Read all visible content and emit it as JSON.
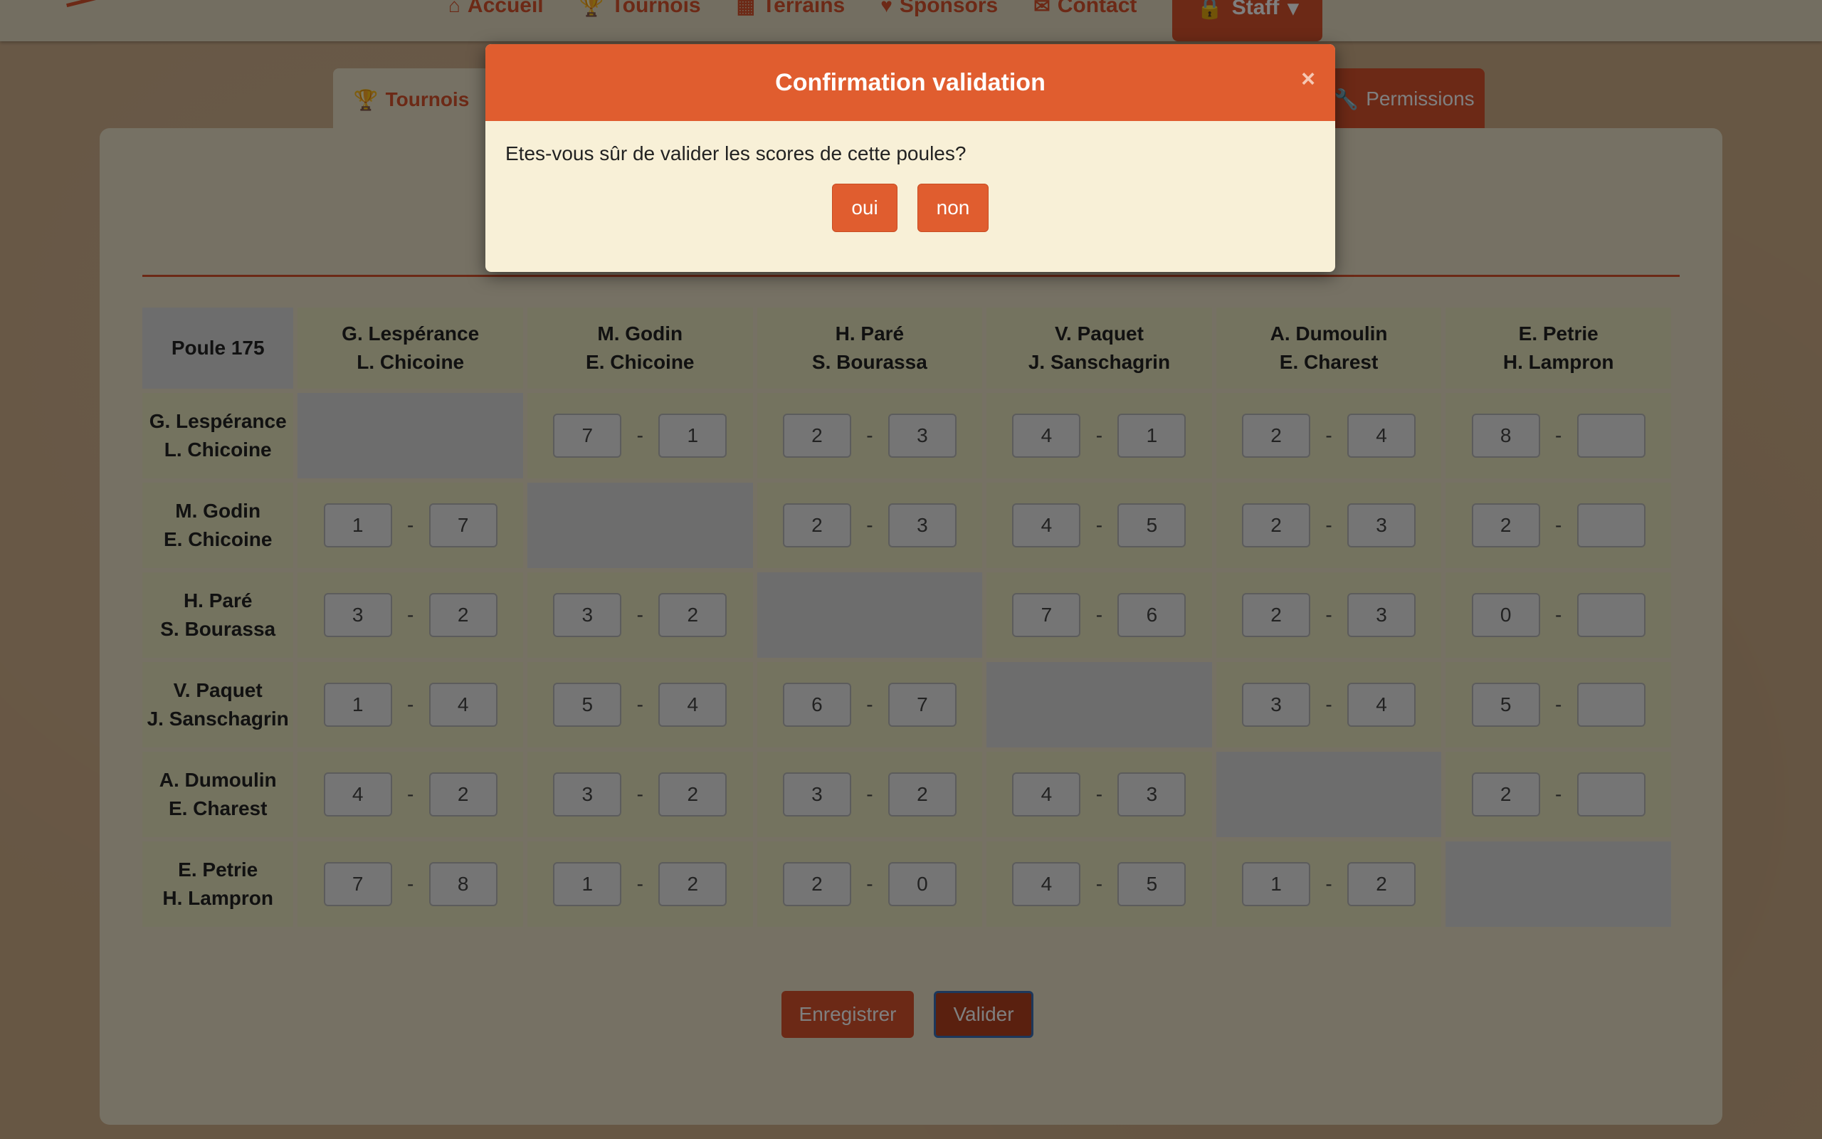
{
  "nav": {
    "items": [
      {
        "label": "Accueil",
        "icon": "home-icon",
        "glyph": "⌂"
      },
      {
        "label": "Tournois",
        "icon": "trophy-icon",
        "glyph": "🏆"
      },
      {
        "label": "Terrains",
        "icon": "grid-icon",
        "glyph": "▦"
      },
      {
        "label": "Sponsors",
        "icon": "heart-icon",
        "glyph": "♥"
      },
      {
        "label": "Contact",
        "icon": "envelope-icon",
        "glyph": "✉"
      }
    ],
    "staff": {
      "label": "Staff",
      "icon": "lock-icon",
      "glyph": "🔒",
      "caret": "▾"
    }
  },
  "tabs": {
    "tournois": {
      "label": "Tournois",
      "glyph": "🏆"
    },
    "permissions": {
      "label": "Permissions",
      "glyph": "🔧"
    }
  },
  "poule": {
    "title": "Poule 175",
    "columns": [
      {
        "line1": "G. Lespérance",
        "line2": "L. Chicoine"
      },
      {
        "line1": "M. Godin",
        "line2": "E. Chicoine"
      },
      {
        "line1": "H. Paré",
        "line2": "S. Bourassa"
      },
      {
        "line1": "V. Paquet",
        "line2": "J. Sanschagrin"
      },
      {
        "line1": "A. Dumoulin",
        "line2": "E. Charest"
      },
      {
        "line1": "E. Petrie",
        "line2": "H. Lampron"
      }
    ],
    "rows": [
      {
        "line1": "G. Lespérance",
        "line2": "L. Chicoine",
        "scores": [
          null,
          [
            "7",
            "1"
          ],
          [
            "2",
            "3"
          ],
          [
            "4",
            "1"
          ],
          [
            "2",
            "4"
          ],
          [
            "8",
            ""
          ]
        ]
      },
      {
        "line1": "M. Godin",
        "line2": "E. Chicoine",
        "scores": [
          [
            "1",
            "7"
          ],
          null,
          [
            "2",
            "3"
          ],
          [
            "4",
            "5"
          ],
          [
            "2",
            "3"
          ],
          [
            "2",
            ""
          ]
        ]
      },
      {
        "line1": "H. Paré",
        "line2": "S. Bourassa",
        "scores": [
          [
            "3",
            "2"
          ],
          [
            "3",
            "2"
          ],
          null,
          [
            "7",
            "6"
          ],
          [
            "2",
            "3"
          ],
          [
            "0",
            ""
          ]
        ]
      },
      {
        "line1": "V. Paquet",
        "line2": "J. Sanschagrin",
        "scores": [
          [
            "1",
            "4"
          ],
          [
            "5",
            "4"
          ],
          [
            "6",
            "7"
          ],
          null,
          [
            "3",
            "4"
          ],
          [
            "5",
            ""
          ]
        ]
      },
      {
        "line1": "A. Dumoulin",
        "line2": "E. Charest",
        "scores": [
          [
            "4",
            "2"
          ],
          [
            "3",
            "2"
          ],
          [
            "3",
            "2"
          ],
          [
            "4",
            "3"
          ],
          null,
          [
            "2",
            ""
          ]
        ]
      },
      {
        "line1": "E. Petrie",
        "line2": "H. Lampron",
        "scores": [
          [
            "7",
            "8"
          ],
          [
            "1",
            "2"
          ],
          [
            "2",
            "0"
          ],
          [
            "4",
            "5"
          ],
          [
            "1",
            "2"
          ],
          null
        ]
      }
    ],
    "dash": "-"
  },
  "actions": {
    "save_label": "Enregistrer",
    "validate_label": "Valider"
  },
  "modal": {
    "title": "Confirmation validation",
    "close": "×",
    "message": "Etes-vous sûr de valider les scores de cette poules?",
    "yes_label": "oui",
    "no_label": "non"
  },
  "colors": {
    "accent": "#d9532d",
    "panel": "#ece3c9",
    "cell": "#e8e6bf"
  }
}
